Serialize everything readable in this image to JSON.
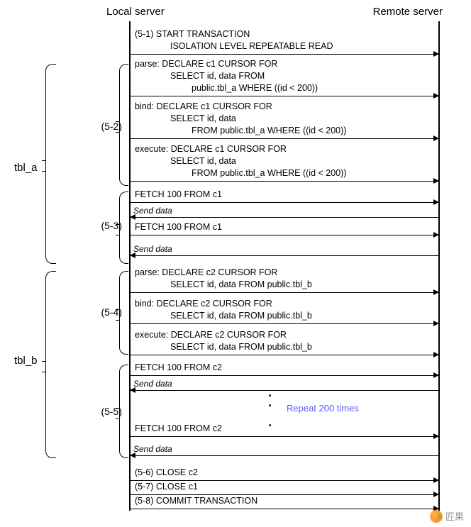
{
  "headers": {
    "local": "Local server",
    "remote": "Remote server"
  },
  "tbl_a": "tbl_a",
  "tbl_b": "tbl_b",
  "steps": {
    "s51_l1": "(5-1) START TRANSACTION",
    "s51_l2": "ISOLATION LEVEL REPEATABLE READ",
    "s52_label": "(5-2)",
    "s52_parse_l1": "parse: DECLARE c1 CURSOR FOR",
    "s52_parse_l2": "SELECT id, data FROM",
    "s52_parse_l3": "public.tbl_a WHERE ((id < 200))",
    "s52_bind_l1": "bind: DECLARE c1 CURSOR FOR",
    "s52_bind_l2": "SELECT id, data",
    "s52_bind_l3": "FROM public.tbl_a WHERE ((id < 200))",
    "s52_exec_l1": "execute: DECLARE c1 CURSOR FOR",
    "s52_exec_l2": "SELECT id, data",
    "s52_exec_l3": "FROM public.tbl_a WHERE ((id < 200))",
    "s53_label": "(5-3)",
    "s53_fetch1": "FETCH 100 FROM c1",
    "s53_send1": "Send data",
    "s53_fetch2": "FETCH 100 FROM c1",
    "s53_send2": "Send data",
    "s54_label": "(5-4)",
    "s54_parse_l1": "parse: DECLARE c2 CURSOR FOR",
    "s54_parse_l2": "SELECT id, data FROM public.tbl_b",
    "s54_bind_l1": "bind: DECLARE c2 CURSOR FOR",
    "s54_bind_l2": "SELECT id, data FROM public.tbl_b",
    "s54_exec_l1": "execute: DECLARE c2 CURSOR FOR",
    "s54_exec_l2": "SELECT id, data FROM public.tbl_b",
    "s55_label": "(5-5)",
    "s55_fetch1": "FETCH 100 FROM c2",
    "s55_send1": "Send data",
    "s55_repeat": "Repeat 200 times",
    "s55_fetch2": "FETCH 100 FROM c2",
    "s55_send2": "Send data",
    "s56": "(5-6) CLOSE c2",
    "s57": "(5-7)  CLOSE c1",
    "s58": "(5-8)  COMMIT TRANSACTION"
  },
  "watermark": "匠果"
}
